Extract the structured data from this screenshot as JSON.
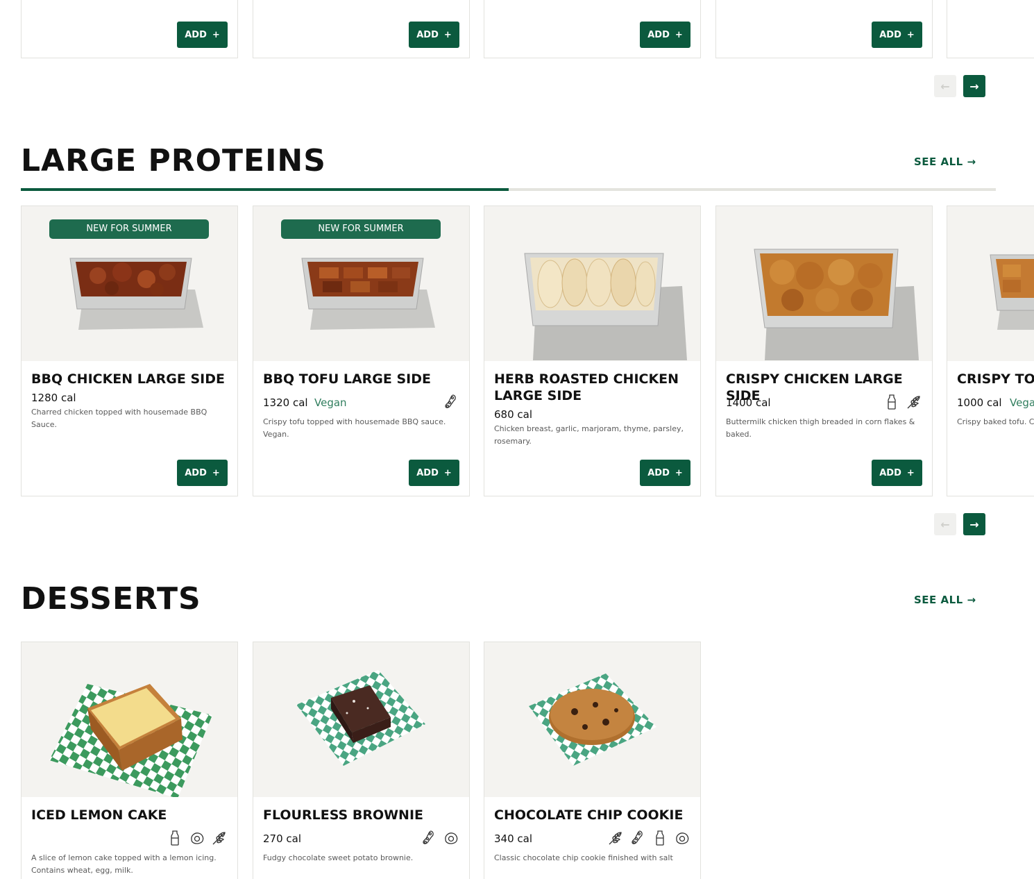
{
  "colors": {
    "accent": "#0b5a3e",
    "badge": "#1e6b4e",
    "vegan_tag": "#2f7d5d",
    "card_image_bg": "#f4f3f0"
  },
  "top_row": {
    "add_label": "ADD",
    "add_icon": "plus-icon",
    "nav": {
      "prev_icon": "arrow-left-icon",
      "next_icon": "arrow-right-icon"
    }
  },
  "large_proteins": {
    "title": "LARGE PROTEINS",
    "see_all": "SEE ALL",
    "see_all_icon": "arrow-right-icon",
    "scroll_progress": 0.5,
    "items": [
      {
        "badge": "NEW FOR SUMMER",
        "name": "BBQ Chicken Large Side",
        "calories": "1280 cal",
        "tag": "",
        "desc": "Charred chicken topped with housemade BBQ Sauce.",
        "icons": [],
        "add_label": "ADD"
      },
      {
        "badge": "NEW FOR SUMMER",
        "name": "BBQ Tofu Large Side",
        "calories": "1320 cal",
        "tag": "Vegan",
        "desc": "Crispy tofu topped with housemade BBQ sauce. Vegan.",
        "icons": [
          "soy-icon"
        ],
        "add_label": "ADD"
      },
      {
        "badge": "",
        "name": "Herb Roasted Chicken Large Side",
        "calories": "680 cal",
        "tag": "",
        "desc": "Chicken breast, garlic, marjoram, thyme, parsley, rosemary.",
        "icons": [],
        "add_label": "ADD"
      },
      {
        "badge": "",
        "name": "Crispy Chicken Large Side",
        "calories": "1400 cal",
        "tag": "",
        "desc": "Buttermilk chicken thigh breaded in corn flakes & baked.",
        "icons": [
          "milk-icon",
          "wheat-icon"
        ],
        "add_label": "ADD"
      },
      {
        "badge": "",
        "name": "Crispy Tof",
        "calories": "1000 cal",
        "tag": "Vegan",
        "desc": "Crispy baked tofu. Co",
        "icons": [],
        "add_label": "ADD"
      }
    ],
    "nav": {
      "prev_icon": "arrow-left-icon",
      "next_icon": "arrow-right-icon"
    }
  },
  "desserts": {
    "title": "DESSERTS",
    "see_all": "SEE ALL",
    "see_all_icon": "arrow-right-icon",
    "items": [
      {
        "name": "Iced Lemon Cake",
        "calories": "",
        "desc": "A slice of lemon cake topped with a lemon icing. Contains wheat, egg, milk.",
        "icons": [
          "milk-icon",
          "egg-icon",
          "wheat-icon"
        ]
      },
      {
        "name": "Flourless Brownie",
        "calories": "270 cal",
        "desc": "Fudgy chocolate sweet potato brownie.",
        "icons": [
          "soy-icon",
          "egg-icon"
        ]
      },
      {
        "name": "Chocolate Chip Cookie",
        "calories": "340 cal",
        "desc": "Classic chocolate chip cookie finished with salt",
        "icons": [
          "wheat-icon",
          "soy-icon",
          "milk-icon",
          "egg-icon"
        ]
      }
    ]
  }
}
